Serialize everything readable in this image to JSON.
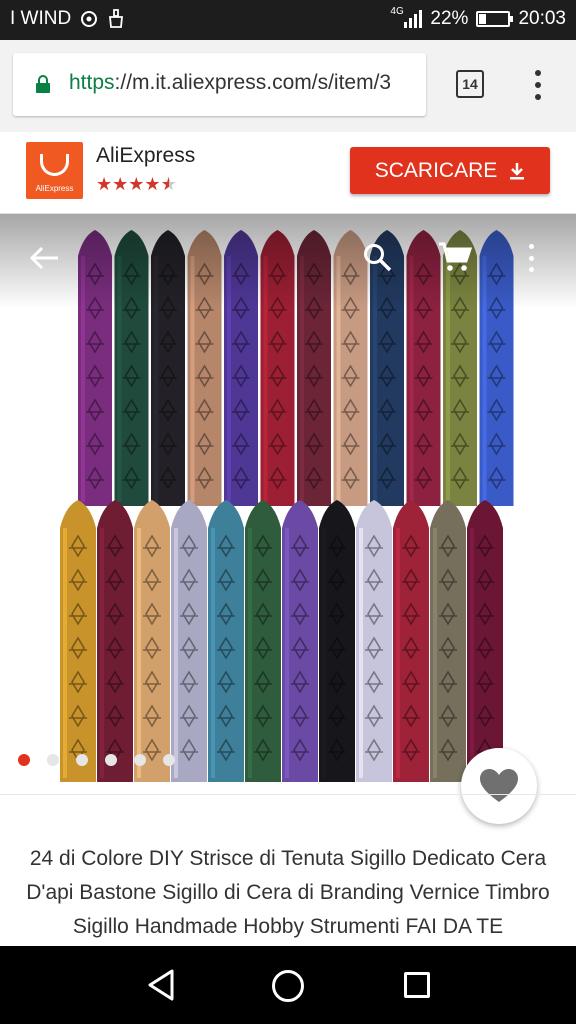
{
  "status_bar": {
    "carrier": "I WIND",
    "network": "4G",
    "battery": "22%",
    "battery_level": 0.22,
    "time": "20:03",
    "icons": [
      "sync-icon",
      "cleaner-icon",
      "signal-icon",
      "battery-icon"
    ]
  },
  "browser": {
    "url_scheme": "https",
    "url_rest": "://m.it.aliexpress.com/s/item/3",
    "tab_count": "14",
    "secure_color": "#0b8043"
  },
  "app_banner": {
    "app_name": "AliExpress",
    "logo_text": "AliExpress",
    "rating": 4.5,
    "rating_max": 5,
    "download_label": "SCARICARE",
    "brand_color": "#e0321d"
  },
  "gallery": {
    "active_index": 0,
    "count": 6,
    "top_row_colors": [
      "#7a2d7e",
      "#1f4a3c",
      "#232127",
      "#b5866a",
      "#4f3796",
      "#9c1f33",
      "#6b2537",
      "#c79a82",
      "#223a60",
      "#8c2140",
      "#7a8440",
      "#3a5bc7"
    ],
    "bottom_row_colors": [
      "#c8932a",
      "#6e1d33",
      "#d2a06a",
      "#a8a8c3",
      "#3e7f9a",
      "#2e5c3d",
      "#6a4aa5",
      "#17161a",
      "#c6c5dc",
      "#9e2238",
      "#756f5c",
      "#6c1636"
    ]
  },
  "product": {
    "title": "24 di Colore DIY Strisce di Tenuta Sigillo Dedicato Cera D'api Bastone Sigillo di Cera di Branding Vernice Timbro Sigillo Handmade Hobby Strumenti FAI DA TE"
  }
}
